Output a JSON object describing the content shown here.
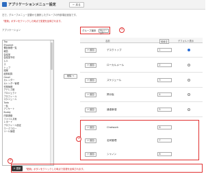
{
  "header": {
    "title": "アプリケーションメニュー設定",
    "back_label": "← 戻る"
  },
  "description": "左で、グループメニュー並替から選択したグループの外部項目追加です。",
  "warning_top": "「更新」ボタンをクリックした時点で変更を反映されます。",
  "left_panel": {
    "label": "アプリケーション",
    "items": [
      "Top",
      "@pocket",
      "備品管理一覧",
      "報告",
      "会議室",
      "会議室予約",
      "ムル",
      "ス",
      "トップ",
      "議案",
      "経費精算",
      "Gmail",
      "カレンダー",
      "カレンダー管理",
      "作業管理",
      "アドレス帳",
      "プロジェクト",
      "プロフィール",
      "スケジュール",
      "Todo",
      "一覧",
      "アンケート",
      "Buddy",
      "内部連絡",
      "ファイル共有",
      "レポート",
      "プロフィール設定",
      "ワークフロー",
      "ツール管理"
    ]
  },
  "group_select": {
    "label": "グループ選択",
    "value": "MyパーツT"
  },
  "badges": {
    "b1": "①",
    "b2": "②",
    "b3": "③"
  },
  "table": {
    "headers": {
      "name": "名前",
      "order": "順番並",
      "default": "デフォルト表示"
    },
    "rows": [
      {
        "add": "← 追加",
        "name": "デスクトップ",
        "order": "1",
        "default": true
      },
      {
        "add": "← 追加",
        "name": "ローカルメール",
        "order": "2",
        "default": false
      },
      {
        "add": "← 追加",
        "name": "スケジュール",
        "order": "3",
        "default": false
      },
      {
        "add": "← 追加",
        "name": "掲示板",
        "order": "4",
        "default": false
      },
      {
        "add": "← 追加",
        "name": "通達事項",
        "order": "5",
        "default": false
      },
      {
        "add": "← 追加",
        "name": "Chatwork",
        "order": "6",
        "default": false
      },
      {
        "add": "← 追加",
        "name": "名刺管理",
        "order": "7",
        "default": false
      },
      {
        "add": "← 追加",
        "name": "シャノン",
        "order": "8",
        "default": false
      }
    ]
  },
  "remove_label": "削除 →",
  "save_label": "更新",
  "warning_bottom": "「更新」ボタンをクリックした時点で変更を反映されます。"
}
